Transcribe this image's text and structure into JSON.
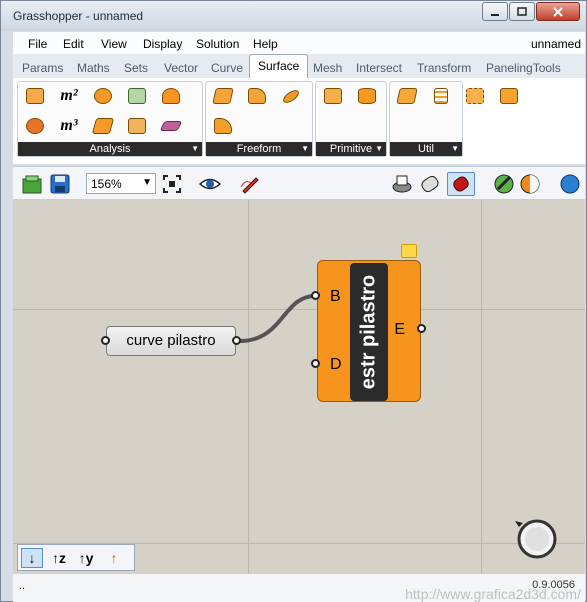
{
  "window": {
    "title": "Grasshopper - unnamed"
  },
  "menu": {
    "items": [
      "File",
      "Edit",
      "View",
      "Display",
      "Solution",
      "Help"
    ],
    "document": "unnamed"
  },
  "tabs": {
    "items": [
      "Params",
      "Maths",
      "Sets",
      "Vector",
      "Curve",
      "Surface",
      "Mesh",
      "Intersect",
      "Transform",
      "PanelingTools"
    ],
    "active": "Surface"
  },
  "ribbon": {
    "groups": [
      {
        "label": "Analysis"
      },
      {
        "label": "Freeform"
      },
      {
        "label": "Primitive"
      },
      {
        "label": "Util"
      }
    ],
    "analysis_texts": [
      "m²",
      "m³"
    ]
  },
  "canvas_toolbar": {
    "zoom": "156%"
  },
  "canvas": {
    "panel": {
      "text": "curve pilastro"
    },
    "cluster": {
      "name": "estr pilastro",
      "inputs": [
        "B",
        "D"
      ],
      "outputs": [
        "E"
      ]
    }
  },
  "mini_toolbar": {
    "buttons": [
      "↓",
      "↑z",
      "↑y",
      "↑"
    ]
  },
  "status": {
    "left": "..",
    "version": "0.9.0056",
    "watermark": "http://www.grafica2d3d.com/"
  },
  "colors": {
    "cluster": "#f7941d",
    "canvas": "#d5d1c6",
    "panel": "#e6e6e6"
  }
}
